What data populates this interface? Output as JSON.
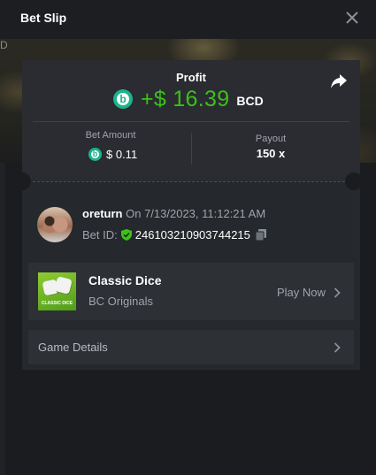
{
  "header": {
    "title": "Bet Slip"
  },
  "background": {
    "side_letter": "D"
  },
  "summary": {
    "profit_label": "Profit",
    "profit_value": "+$ 16.39",
    "profit_currency": "BCD",
    "bet_amount_label": "Bet Amount",
    "bet_amount_value": "$ 0.11",
    "payout_label": "Payout",
    "payout_value": "150 x"
  },
  "bet_info": {
    "username": "oreturn",
    "date_text": " On 7/13/2023, 11:12:21 AM",
    "bet_id_label": "Bet ID:",
    "bet_id_value": "246103210903744215"
  },
  "game": {
    "thumb_text": "CLASSIC DICE",
    "name": "Classic Dice",
    "provider": "BC Originals",
    "play_label": "Play Now"
  },
  "details": {
    "label": "Game Details"
  },
  "colors": {
    "profit_green": "#3bc117",
    "coin_teal": "#1bb48b",
    "shield_green": "#3bc117"
  }
}
